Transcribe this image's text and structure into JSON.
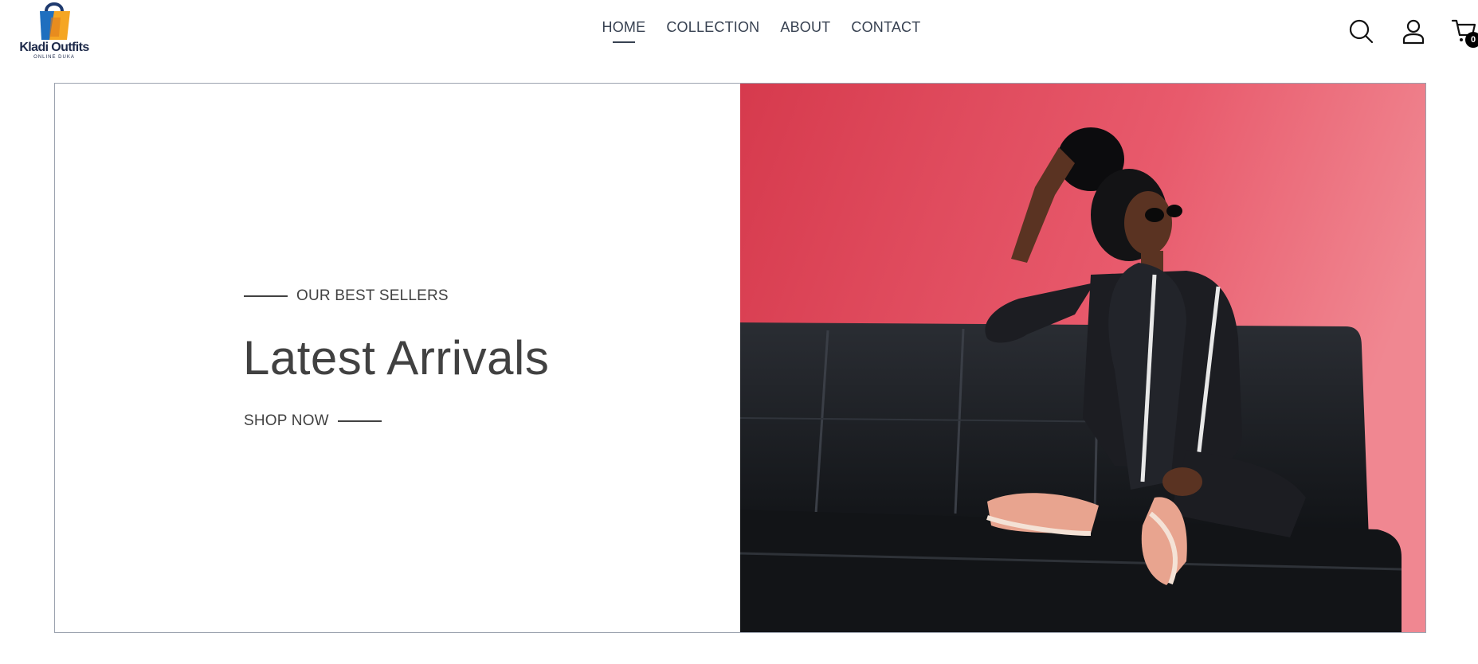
{
  "brand": {
    "name": "Kladi Outfits",
    "tagline": "ONLINE DUKA"
  },
  "nav": {
    "items": [
      {
        "label": "HOME",
        "active": true
      },
      {
        "label": "COLLECTION",
        "active": false
      },
      {
        "label": "ABOUT",
        "active": false
      },
      {
        "label": "CONTACT",
        "active": false
      }
    ]
  },
  "header_icons": {
    "search": "search-icon",
    "profile": "user-icon",
    "cart": "cart-icon",
    "cart_count": "0"
  },
  "hero": {
    "kicker": "OUR BEST SELLERS",
    "title": "Latest Arrivals",
    "cta": "SHOP NOW"
  },
  "colors": {
    "text": "#414141",
    "hero_bg": "#e35266",
    "sofa": "#16181c",
    "badge": "#000000"
  }
}
